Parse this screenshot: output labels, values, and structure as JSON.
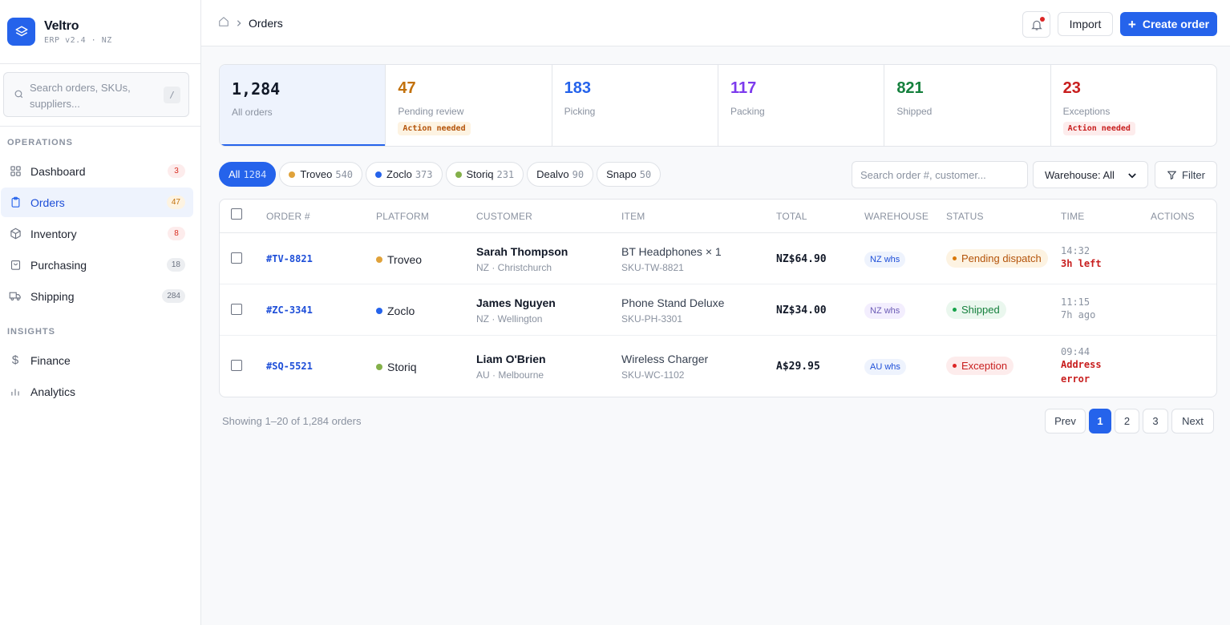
{
  "brand": {
    "name": "Veltro",
    "sub": "ERP v2.4 · NZ"
  },
  "sidebar": {
    "search_placeholder": "Search orders, SKUs, suppliers...",
    "search_kbd": "/",
    "section_ops": "OPERATIONS",
    "section_insights": "INSIGHTS",
    "items": [
      {
        "label": "Dashboard",
        "badge": "3",
        "icon": "grid-icon"
      },
      {
        "label": "Orders",
        "badge": "47",
        "icon": "clipboard-icon"
      },
      {
        "label": "Inventory",
        "badge": "8",
        "icon": "box-icon"
      },
      {
        "label": "Purchasing",
        "badge": "18",
        "icon": "bag-icon"
      },
      {
        "label": "Shipping",
        "badge": "284",
        "icon": "truck-icon"
      },
      {
        "label": "Finance",
        "icon": "dollar-icon"
      },
      {
        "label": "Analytics",
        "icon": "bar-chart-icon"
      }
    ]
  },
  "topbar": {
    "breadcrumb_current": "Orders",
    "import_label": "Import",
    "create_label": "Create order"
  },
  "stats": [
    {
      "value": "1,284",
      "label": "All orders",
      "color": "#111827"
    },
    {
      "value": "47",
      "label": "Pending review",
      "color": "#c2710c",
      "tag": "Action needed"
    },
    {
      "value": "183",
      "label": "Picking",
      "color": "#2563eb"
    },
    {
      "value": "117",
      "label": "Packing",
      "color": "#7c3aed"
    },
    {
      "value": "821",
      "label": "Shipped",
      "color": "#15803d"
    },
    {
      "value": "23",
      "label": "Exceptions",
      "color": "#c81e1e",
      "tag": "Action needed"
    }
  ],
  "filters": {
    "chips": [
      {
        "label": "All",
        "count": "1284"
      },
      {
        "label": "Troveo",
        "count": "540",
        "color": "#e0a23a"
      },
      {
        "label": "Zoclo",
        "count": "373",
        "color": "#2563eb"
      },
      {
        "label": "Storiq",
        "count": "231",
        "color": "#84b04a"
      },
      {
        "label": "Dealvo",
        "count": "90"
      },
      {
        "label": "Snapo",
        "count": "50"
      }
    ],
    "search_placeholder": "Search order #, customer...",
    "warehouse": "Warehouse: All",
    "filter_label": "Filter"
  },
  "table": {
    "headers": [
      "ORDER #",
      "PLATFORM",
      "CUSTOMER",
      "ITEM",
      "TOTAL",
      "WAREHOUSE",
      "STATUS",
      "TIME",
      "ACTIONS"
    ],
    "rows": [
      {
        "order": "#TV-8821",
        "platform": "Troveo",
        "platform_color": "#e0a23a",
        "customer": "Sarah Thompson",
        "location": "NZ · Christchurch",
        "item": "BT Headphones × 1",
        "sku": "SKU-TW-8821",
        "total": "NZ$64.90",
        "warehouse": "NZ whs",
        "status": "Pending dispatch",
        "time": "14:32",
        "time_sub": "3h left"
      },
      {
        "order": "#ZC-3341",
        "platform": "Zoclo",
        "platform_color": "#2563eb",
        "customer": "James Nguyen",
        "location": "NZ · Wellington",
        "item": "Phone Stand Deluxe",
        "sku": "SKU-PH-3301",
        "total": "NZ$34.00",
        "warehouse": "NZ whs",
        "status": "Shipped",
        "time": "11:15",
        "time_sub": "7h ago"
      },
      {
        "order": "#SQ-5521",
        "platform": "Storiq",
        "platform_color": "#84b04a",
        "customer": "Liam O'Brien",
        "location": "AU · Melbourne",
        "item": "Wireless Charger",
        "sku": "SKU-WC-1102",
        "total": "A$29.95",
        "warehouse": "AU whs",
        "status": "Exception",
        "time": "09:44",
        "time_sub": "Address error"
      }
    ]
  },
  "pagination": {
    "showing": "Showing 1–20 of 1,284 orders",
    "prev": "Prev",
    "pages": [
      "1",
      "2",
      "3"
    ],
    "next": "Next"
  },
  "colors": {
    "accent": "#2563eb"
  }
}
